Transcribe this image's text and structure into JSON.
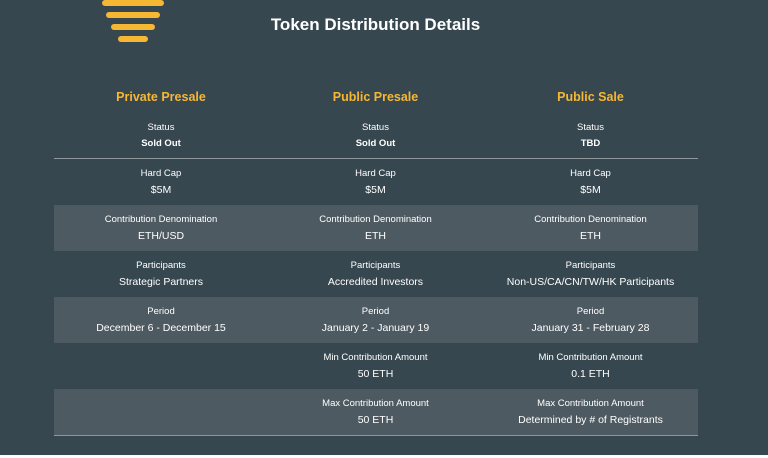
{
  "page": {
    "title": "Token Distribution Details"
  },
  "colors": {
    "background": "#37474f",
    "accent": "#f6b733",
    "alt_row": "#4e5a61"
  },
  "logo": {
    "icon": "bee-stripes-icon"
  },
  "columns": [
    {
      "heading": "Private Presale"
    },
    {
      "heading": "Public Presale"
    },
    {
      "heading": "Public Sale"
    }
  ],
  "rows": [
    {
      "label": "Status",
      "values": [
        "Sold Out",
        "Sold Out",
        "TBD"
      ]
    },
    {
      "label": "Hard Cap",
      "values": [
        "$5M",
        "$5M",
        "$5M"
      ]
    },
    {
      "label": "Contribution Denomination",
      "values": [
        "ETH/USD",
        "ETH",
        "ETH"
      ]
    },
    {
      "label": "Participants",
      "values": [
        "Strategic Partners",
        "Accredited Investors",
        "Non-US/CA/CN/TW/HK Participants"
      ]
    },
    {
      "label": "Period",
      "values": [
        "December 6 - December 15",
        "January 2 - January 19",
        "January 31 - February 28"
      ]
    },
    {
      "label": "Min Contribution Amount",
      "values": [
        "",
        "50 ETH",
        "0.1 ETH"
      ]
    },
    {
      "label": "Max Contribution Amount",
      "values": [
        "",
        "50 ETH",
        "Determined by # of Registrants"
      ]
    }
  ]
}
